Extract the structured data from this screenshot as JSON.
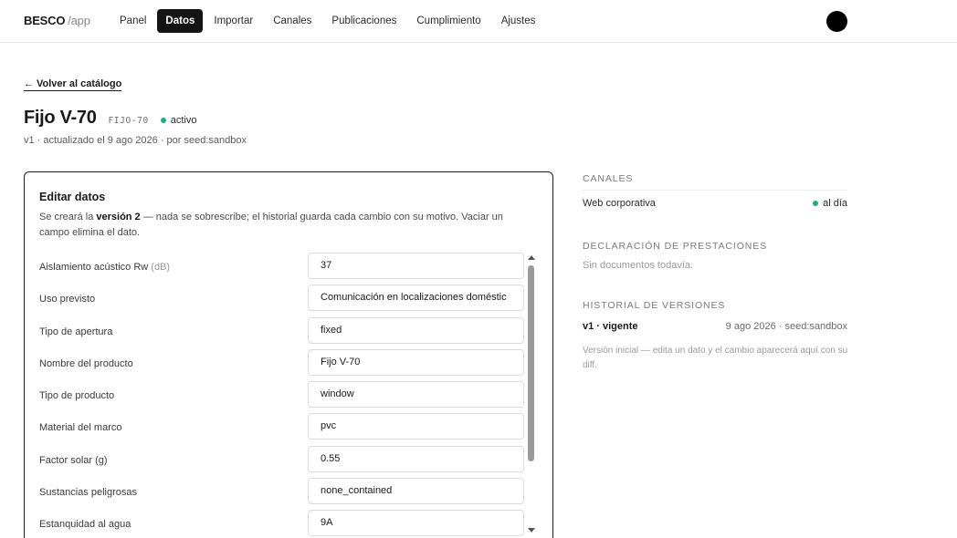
{
  "brand": {
    "name": "BESCO",
    "sub": "/app"
  },
  "nav": [
    {
      "label": "Panel",
      "active": false
    },
    {
      "label": "Datos",
      "active": true
    },
    {
      "label": "Importar",
      "active": false
    },
    {
      "label": "Canales",
      "active": false
    },
    {
      "label": "Publicaciones",
      "active": false
    },
    {
      "label": "Cumplimiento",
      "active": false
    },
    {
      "label": "Ajustes",
      "active": false
    }
  ],
  "back": {
    "arrow": "←",
    "label": "Volver al catálogo"
  },
  "product": {
    "title": "Fijo V-70",
    "code": "FIJO-70",
    "status": "activo",
    "meta": "v1 · actualizado el 9 ago 2026 · por seed:sandbox"
  },
  "editor": {
    "title": "Editar datos",
    "desc_pre": "Se creará la ",
    "desc_bold": "versión 2",
    "desc_post": " — nada se sobrescribe; el historial guarda cada cambio con su motivo. Vaciar un campo elimina el dato.",
    "fields": [
      {
        "label": "Aislamiento acústico Rw",
        "unit": "(dB)",
        "value": "37"
      },
      {
        "label": "Uso previsto",
        "unit": "",
        "value": "Comunicación en localizaciones doméstic"
      },
      {
        "label": "Tipo de apertura",
        "unit": "",
        "value": "fixed"
      },
      {
        "label": "Nombre del producto",
        "unit": "",
        "value": "Fijo V-70"
      },
      {
        "label": "Tipo de producto",
        "unit": "",
        "value": "window"
      },
      {
        "label": "Material del marco",
        "unit": "",
        "value": "pvc"
      },
      {
        "label": "Factor solar (g)",
        "unit": "",
        "value": "0.55"
      },
      {
        "label": "Sustancias peligrosas",
        "unit": "",
        "value": "none_contained"
      },
      {
        "label": "Estanquidad al agua",
        "unit": "",
        "value": "9A"
      }
    ]
  },
  "sidebar": {
    "channels": {
      "heading": "Canales",
      "items": [
        {
          "name": "Web corporativa",
          "status": "al día",
          "status_color": "#18b37c"
        }
      ]
    },
    "declarations": {
      "heading": "Declaración de prestaciones",
      "empty": "Sin documentos todavía."
    },
    "history": {
      "heading": "Historial de versiones",
      "items": [
        {
          "name": "v1 · vigente",
          "meta": "9 ago 2026 · seed:sandbox"
        }
      ],
      "note": "Versión inicial — edita un dato y el cambio aparecerá aquí con su diff."
    }
  }
}
